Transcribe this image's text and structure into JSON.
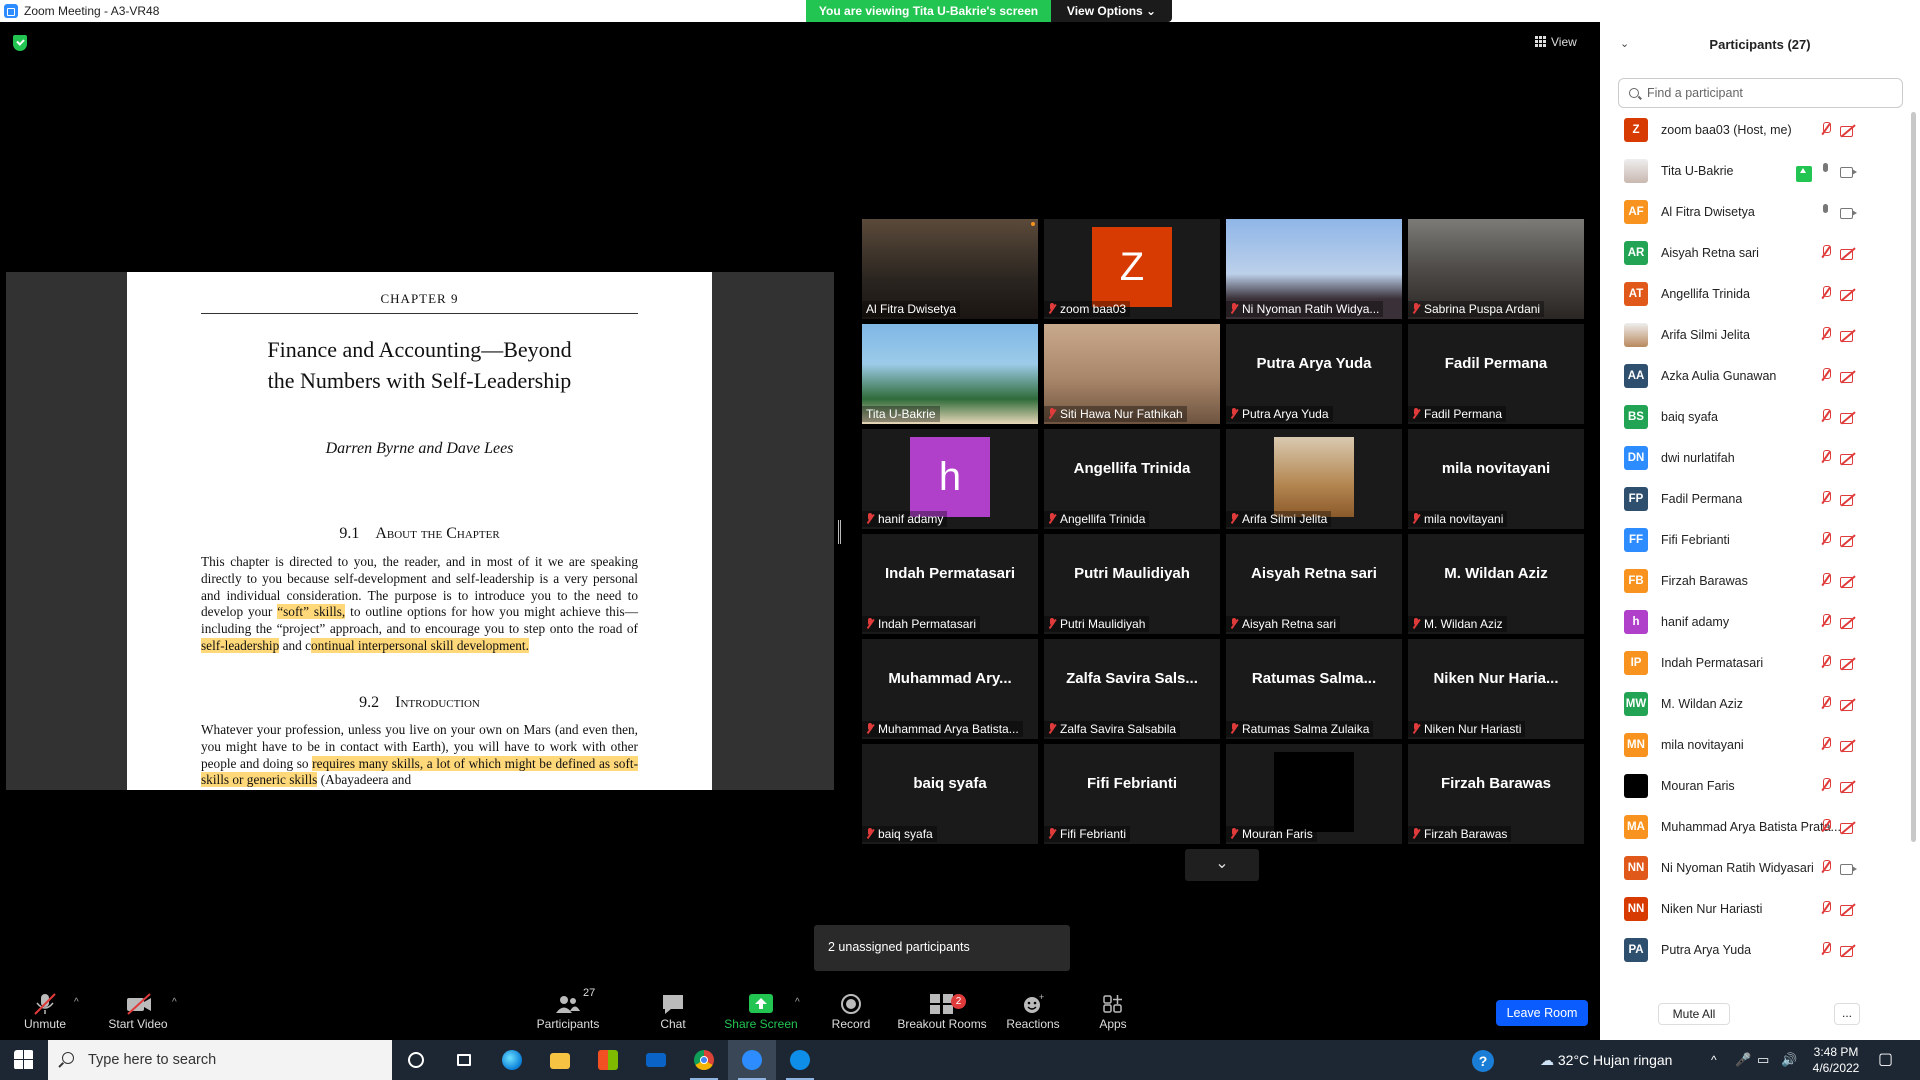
{
  "window": {
    "title": "Zoom Meeting - A3-VR48",
    "viewing_banner": "You are viewing Tita U-Bakrie's screen",
    "view_options": "View Options ⌄",
    "view_button": "View"
  },
  "shared_page": {
    "chapter": "CHAPTER 9",
    "title_line1": "Finance and Accounting—Beyond",
    "title_line2": "the Numbers with Self-Leadership",
    "authors": "Darren Byrne and Dave Lees",
    "sec1_num": "9.1",
    "sec1_title": "About the Chapter",
    "para1_a": "This chapter is directed to you, the reader, and in most of it we are speaking directly to you because self-development and self-leadership is a very personal and individual consideration. The purpose is to introduce you to the need to develop your ",
    "para1_hl1": "“soft” skills,",
    "para1_b": " to outline options for how you might achieve this—including the “project” approach, and to encourage you to step onto the road of ",
    "para1_hl2": "self-leadership",
    "para1_c": " and c",
    "para1_hl3": "ontinual interpersonal skill development.",
    "sec2_num": "9.2",
    "sec2_title": "Introduction",
    "para2_a": "Whatever your profession, unless you live on your own on Mars (and even then, you might have to be in contact with Earth), you will have to work with other people and doing so ",
    "para2_hl1": "requires many skills, a lot of which might be defined as soft-skills or generic skills",
    "para2_b": " (Abayadeera and"
  },
  "gallery": [
    {
      "label": "Al Fitra Dwisetya",
      "type": "video",
      "active": true
    },
    {
      "label": "zoom baa03",
      "type": "avatar",
      "letter": "Z",
      "color": "#d83b01"
    },
    {
      "label": "Ni Nyoman Ratih Widya...",
      "type": "video"
    },
    {
      "label": "Sabrina Puspa Ardani",
      "type": "video"
    },
    {
      "label": "Tita U-Bakrie",
      "type": "video"
    },
    {
      "label": "Siti Hawa Nur Fathikah",
      "type": "video"
    },
    {
      "label": "Putra Arya Yuda",
      "type": "name",
      "name": "Putra Arya Yuda"
    },
    {
      "label": "Fadil Permana",
      "type": "name",
      "name": "Fadil Permana"
    },
    {
      "label": "hanif adamy",
      "type": "avatar",
      "letter": "h",
      "color": "#b03fc9"
    },
    {
      "label": "Angellifa Trinida",
      "type": "name",
      "name": "Angellifa Trinida"
    },
    {
      "label": "Arifa Silmi Jelita",
      "type": "photo"
    },
    {
      "label": "mila novitayani",
      "type": "name",
      "name": "mila novitayani"
    },
    {
      "label": "Indah Permatasari",
      "type": "name",
      "name": "Indah Permatasari"
    },
    {
      "label": "Putri Maulidiyah",
      "type": "name",
      "name": "Putri Maulidiyah"
    },
    {
      "label": "Aisyah Retna sari",
      "type": "name",
      "name": "Aisyah Retna sari"
    },
    {
      "label": "M. Wildan Aziz",
      "type": "name",
      "name": "M. Wildan Aziz"
    },
    {
      "label": "Muhammad Arya Batista...",
      "type": "name",
      "name": "Muhammad Ary..."
    },
    {
      "label": "Zalfa Savira Salsabila",
      "type": "name",
      "name": "Zalfa Savira Sals..."
    },
    {
      "label": "Ratumas Salma Zulaika",
      "type": "name",
      "name": "Ratumas Salma..."
    },
    {
      "label": "Niken Nur Hariasti",
      "type": "name",
      "name": "Niken Nur Haria..."
    },
    {
      "label": "baiq syafa",
      "type": "name",
      "name": "baiq syafa"
    },
    {
      "label": "Fifi Febrianti",
      "type": "name",
      "name": "Fifi Febrianti"
    },
    {
      "label": "Mouran Faris",
      "type": "black"
    },
    {
      "label": "Firzah Barawas",
      "type": "name",
      "name": "Firzah Barawas"
    }
  ],
  "unassigned": "2 unassigned participants",
  "toolbar": {
    "unmute": "Unmute",
    "start_video": "Start Video",
    "participants": "Participants",
    "participants_count": "27",
    "chat": "Chat",
    "share_screen": "Share Screen",
    "record": "Record",
    "breakout": "Breakout Rooms",
    "breakout_badge": "2",
    "reactions": "Reactions",
    "apps": "Apps",
    "leave": "Leave Room"
  },
  "panel": {
    "title": "Participants (27)",
    "search_placeholder": "Find a participant",
    "mute_all": "Mute All",
    "more": "...",
    "participants": [
      {
        "initials": "Z",
        "name": "zoom baa03 (Host, me)",
        "color": "#d83b01",
        "mic": "muted",
        "cam": "off"
      },
      {
        "initials": "",
        "name": "Tita U-Bakrie",
        "color": "#c9b8b0",
        "mic": "on",
        "cam": "on",
        "sharing": true
      },
      {
        "initials": "AF",
        "name": "Al Fitra Dwisetya",
        "color": "#f7931e",
        "mic": "on",
        "cam": "on"
      },
      {
        "initials": "AR",
        "name": "Aisyah Retna sari",
        "color": "#23a455",
        "mic": "muted",
        "cam": "off"
      },
      {
        "initials": "AT",
        "name": "Angellifa Trinida",
        "color": "#e0581a",
        "mic": "muted",
        "cam": "off"
      },
      {
        "initials": "",
        "name": "Arifa Silmi Jelita",
        "color": "#b98a5e",
        "mic": "muted",
        "cam": "off"
      },
      {
        "initials": "AA",
        "name": "Azka Aulia Gunawan",
        "color": "#2f4f6f",
        "mic": "muted",
        "cam": "off"
      },
      {
        "initials": "BS",
        "name": "baiq syafa",
        "color": "#23a455",
        "mic": "muted",
        "cam": "off"
      },
      {
        "initials": "DN",
        "name": "dwi nurlatifah",
        "color": "#2d8cff",
        "mic": "muted",
        "cam": "off"
      },
      {
        "initials": "FP",
        "name": "Fadil Permana",
        "color": "#2f4f6f",
        "mic": "muted",
        "cam": "off"
      },
      {
        "initials": "FF",
        "name": "Fifi Febrianti",
        "color": "#2d8cff",
        "mic": "muted",
        "cam": "off"
      },
      {
        "initials": "FB",
        "name": "Firzah Barawas",
        "color": "#f7931e",
        "mic": "muted",
        "cam": "off"
      },
      {
        "initials": "h",
        "name": "hanif adamy",
        "color": "#b03fc9",
        "mic": "muted",
        "cam": "off"
      },
      {
        "initials": "IP",
        "name": "Indah Permatasari",
        "color": "#f7931e",
        "mic": "muted",
        "cam": "off"
      },
      {
        "initials": "MW",
        "name": "M. Wildan Aziz",
        "color": "#23a455",
        "mic": "muted",
        "cam": "off"
      },
      {
        "initials": "MN",
        "name": "mila novitayani",
        "color": "#f7931e",
        "mic": "muted",
        "cam": "off"
      },
      {
        "initials": "",
        "name": "Mouran Faris",
        "color": "#000000",
        "mic": "muted",
        "cam": "off"
      },
      {
        "initials": "MA",
        "name": "Muhammad Arya Batista Prata...",
        "color": "#f7931e",
        "mic": "muted",
        "cam": "off"
      },
      {
        "initials": "NN",
        "name": "Ni Nyoman Ratih Widyasari",
        "color": "#e0581a",
        "mic": "muted",
        "cam": "on"
      },
      {
        "initials": "NN",
        "name": "Niken Nur Hariasti",
        "color": "#d83b01",
        "mic": "muted",
        "cam": "off"
      },
      {
        "initials": "PA",
        "name": "Putra Arya Yuda",
        "color": "#2f4f6f",
        "mic": "muted",
        "cam": "off"
      }
    ]
  },
  "taskbar": {
    "search_placeholder": "Type here to search",
    "weather": "32°C  Hujan ringan",
    "time": "3:48 PM",
    "date": "4/6/2022"
  }
}
